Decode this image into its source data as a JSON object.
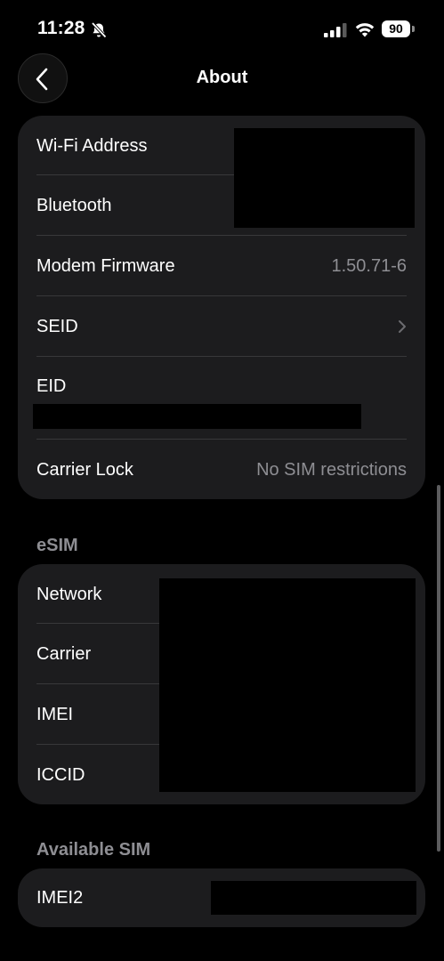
{
  "status_bar": {
    "time": "11:28",
    "battery": "90"
  },
  "nav": {
    "title": "About"
  },
  "card_main": {
    "rows": [
      {
        "label": "Wi-Fi Address",
        "value": ""
      },
      {
        "label": "Bluetooth",
        "value": ""
      },
      {
        "label": "Modem Firmware",
        "value": "1.50.71-6"
      },
      {
        "label": "SEID",
        "value": ""
      },
      {
        "label": "EID",
        "value": ""
      },
      {
        "label": "Carrier Lock",
        "value": "No SIM restrictions"
      }
    ]
  },
  "esim": {
    "header": "eSIM",
    "rows": [
      {
        "label": "Network"
      },
      {
        "label": "Carrier"
      },
      {
        "label": "IMEI"
      },
      {
        "label": "ICCID"
      }
    ]
  },
  "available_sim": {
    "header": "Available SIM",
    "rows": [
      {
        "label": "IMEI2"
      }
    ]
  },
  "icons": {
    "back": "chevron-left-icon",
    "seid": "chevron-right-icon",
    "silent": "bell-slash-icon",
    "signal": "cellular-signal-icon",
    "wifi": "wifi-icon",
    "battery": "battery-icon"
  }
}
